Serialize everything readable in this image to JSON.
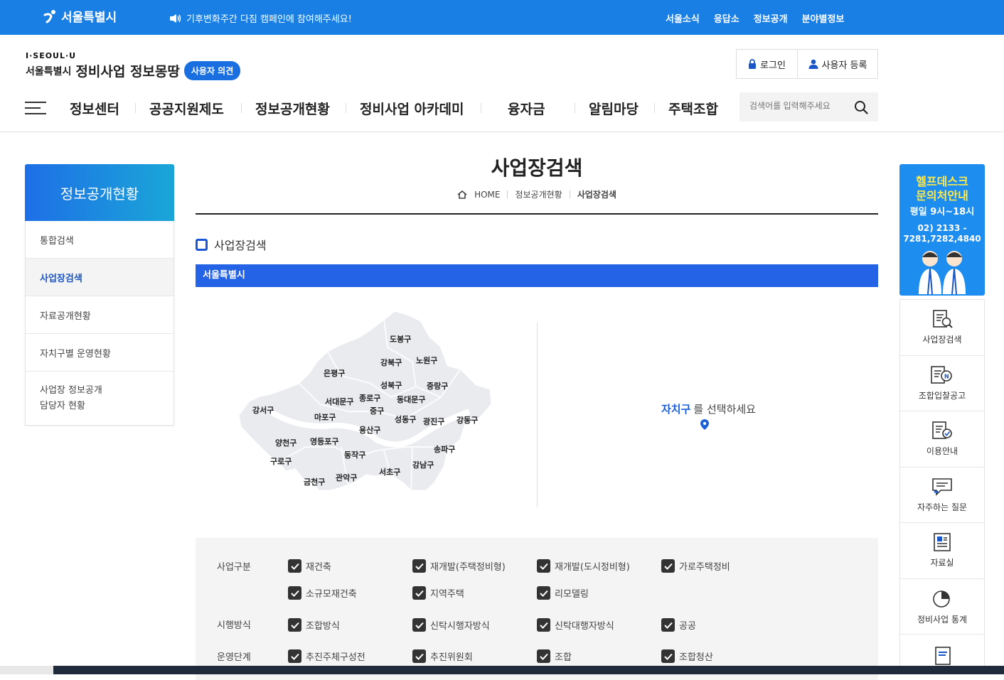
{
  "topbar": {
    "logo_text": "서울특별시",
    "notice": "기후변화주간 다짐 캠페인에 참여해주세요!",
    "links": [
      "서울소식",
      "응답소",
      "정보공개",
      "분야별정보"
    ]
  },
  "header": {
    "iseoul": "I·SEOUL·U",
    "city": "서울특별시",
    "title": "정비사업 정보몽땅",
    "opinion_button": "사용자 의견",
    "login": "로그인",
    "register": "사용자 등록",
    "nav": [
      "정보센터",
      "공공지원제도",
      "정보공개현황",
      "정비사업 아카데미",
      "융자금",
      "알림마당",
      "주택조합"
    ],
    "search_placeholder": "검색어를 입력해주세요"
  },
  "sidebar": {
    "title": "정보공개현황",
    "items": [
      {
        "label": "통합검색",
        "active": false
      },
      {
        "label": "사업장검색",
        "active": true
      },
      {
        "label": "자료공개현황",
        "active": false
      },
      {
        "label": "자치구별 운영현황",
        "active": false
      },
      {
        "label": "사업장 정보공개\n담당자 현황",
        "active": false
      }
    ]
  },
  "main": {
    "title": "사업장검색",
    "breadcrumb": [
      "HOME",
      "정보공개현황",
      "사업장검색"
    ],
    "section_title": "사업장검색",
    "region_bar": "서울특별시",
    "select_hint_strong": "자치구",
    "select_hint_rest": "를 선택하세요",
    "districts": [
      "도봉구",
      "노원구",
      "강북구",
      "은평구",
      "성북구",
      "중랑구",
      "서대문구",
      "종로구",
      "동대문구",
      "중구",
      "강서구",
      "마포구",
      "성동구",
      "광진구",
      "강동구",
      "용산구",
      "양천구",
      "영등포구",
      "송파구",
      "구로구",
      "동작구",
      "강남구",
      "서초구",
      "금천구",
      "관악구"
    ]
  },
  "filters": {
    "business_type_label": "사업구분",
    "business_types": [
      "재건축",
      "재개발(주택정비형)",
      "재개발(도시정비형)",
      "가로주택정비",
      "소규모재건축",
      "지역주택",
      "리모델링"
    ],
    "method_label": "시행방식",
    "methods": [
      "조합방식",
      "신탁시행자방식",
      "신탁대행자방식",
      "공공"
    ],
    "stage_label": "운영단계",
    "stages": [
      "추진주체구성전",
      "추진위원회",
      "조합",
      "조합청산"
    ]
  },
  "helpdesk": {
    "line1": "헬프데스크",
    "line2": "문의처안내",
    "hours": "평일 9시~18시",
    "phone1": "02) 2133 -",
    "phone2": "7281,7282,4840"
  },
  "quick_menu": [
    "사업장검색",
    "조합입찰공고",
    "이용안내",
    "자주하는 질문",
    "자료실",
    "정비사업 통계"
  ],
  "colors": {
    "topbar": "#1a7fe5",
    "accent": "#2463e6",
    "brand_blue": "#1a56c8"
  }
}
